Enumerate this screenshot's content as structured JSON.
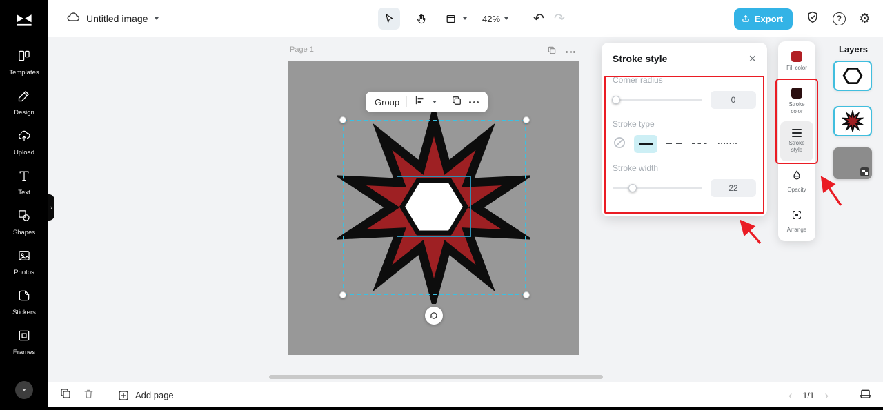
{
  "topbar": {
    "file_title": "Untitled image",
    "zoom_level": "42%",
    "export_label": "Export"
  },
  "sidebar": {
    "items": [
      {
        "label": "Templates"
      },
      {
        "label": "Design"
      },
      {
        "label": "Upload"
      },
      {
        "label": "Text"
      },
      {
        "label": "Shapes"
      },
      {
        "label": "Photos"
      },
      {
        "label": "Stickers"
      },
      {
        "label": "Frames"
      }
    ]
  },
  "canvas": {
    "page_label": "Page 1",
    "group_toolbar": {
      "group_label": "Group"
    }
  },
  "stroke_panel": {
    "title": "Stroke style",
    "corner_radius": {
      "label": "Corner radius",
      "value": "0"
    },
    "stroke_type": {
      "label": "Stroke type",
      "options": [
        "none",
        "solid",
        "dash",
        "dash-small",
        "dotted"
      ],
      "selected": "solid"
    },
    "stroke_width": {
      "label": "Stroke width",
      "value": "22"
    }
  },
  "right_tools": {
    "items": [
      {
        "label": "Fill color"
      },
      {
        "label": "Stroke color"
      },
      {
        "label": "Stroke style"
      },
      {
        "label": "Opacity"
      },
      {
        "label": "Arrange"
      }
    ]
  },
  "layers": {
    "title": "Layers"
  },
  "bottombar": {
    "add_page_label": "Add page",
    "page_indicator": "1/1"
  },
  "colors": {
    "accent_blue": "#33b3e6",
    "selection_cyan": "#3bc0e2",
    "annotation_red": "#ea1c24",
    "star_fill": "#9e2023",
    "star_stroke": "#0d0d0d",
    "page_gray": "#989898",
    "stroke_type_active_bg": "#cdeff5"
  }
}
